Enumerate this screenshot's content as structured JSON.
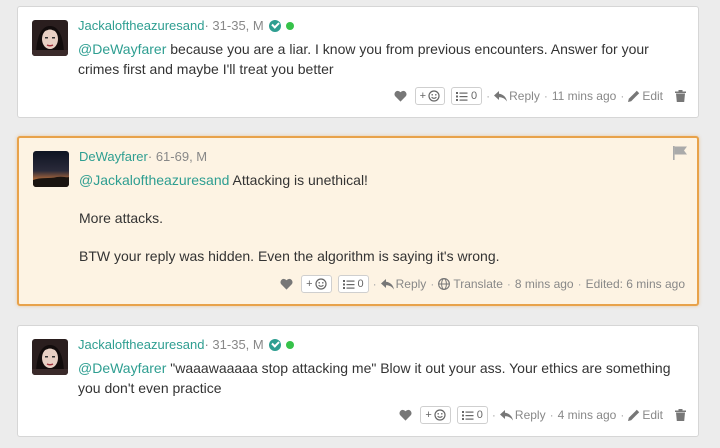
{
  "comments": [
    {
      "username": "Jackaloftheazuresand",
      "meta": " · 31-35, M",
      "verified": true,
      "online": true,
      "mention": "@DeWayfarer",
      "text": " because you are a liar. I know you from previous encounters. Answer for your crimes first and maybe I'll treat you better",
      "reactions_add": "+",
      "list_count": "0",
      "reply_label": "Reply",
      "time": "11 mins ago",
      "edit_label": "Edit"
    },
    {
      "username": "DeWayfarer",
      "meta": " · 61-69, M",
      "mention": "@Jackaloftheazuresand",
      "text": " Attacking is unethical!",
      "para2": "More attacks.",
      "para3": "BTW your reply was hidden. Even the algorithm is saying it's wrong.",
      "reactions_add": "+",
      "list_count": "0",
      "reply_label": "Reply",
      "translate_label": "Translate",
      "time": "8 mins ago",
      "edited": "Edited: 6 mins ago"
    },
    {
      "username": "Jackaloftheazuresand",
      "meta": " · 31-35, M",
      "verified": true,
      "online": true,
      "mention": "@DeWayfarer",
      "text": " \"waaawaaaaa stop attacking me\" Blow it out your ass. Your ethics are something you don't even practice",
      "reactions_add": "+",
      "list_count": "0",
      "reply_label": "Reply",
      "time": "4 mins ago",
      "edit_label": "Edit"
    }
  ],
  "colors": {
    "accent": "#2e9e91",
    "highlight_border": "#e8a24a",
    "highlight_bg": "#fdf3e3",
    "online": "#36c24a"
  },
  "icons": [
    "heart-icon",
    "smiley-icon",
    "list-icon",
    "reply-icon",
    "globe-icon",
    "pencil-icon",
    "trash-icon",
    "flag-icon",
    "verified-icon"
  ]
}
